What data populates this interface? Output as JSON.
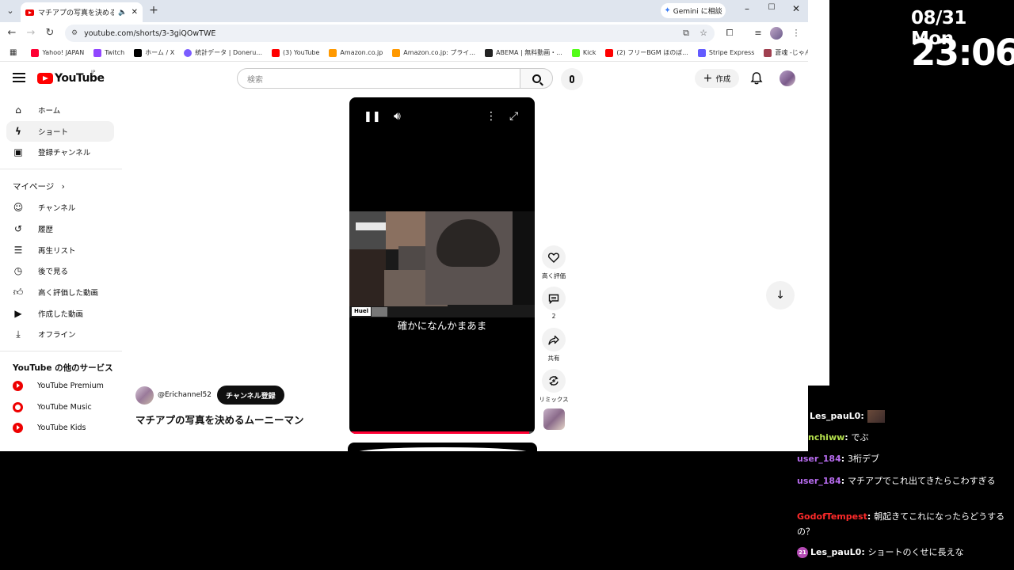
{
  "browser": {
    "tab_title": "マチアプの写真を決めるムーニー",
    "new_tab": "+",
    "gemini_label": "Gemini に相談",
    "url": "youtube.com/shorts/3-3giQOwTWE",
    "bookmarks": [
      {
        "label": "Yahoo! JAPAN",
        "color": "#ff0033"
      },
      {
        "label": "Twitch",
        "color": "#9146ff"
      },
      {
        "label": "ホーム / X",
        "color": "#000000"
      },
      {
        "label": "統計データ | Doneru...",
        "color": "#7b5cff"
      },
      {
        "label": "(3) YouTube",
        "color": "#ff0000"
      },
      {
        "label": "Amazon.co.jp",
        "color": "#ff9900"
      },
      {
        "label": "Amazon.co.jp: プライ...",
        "color": "#ff9900"
      },
      {
        "label": "ABEMA | 無料動画・...",
        "color": "#222222"
      },
      {
        "label": "Kick",
        "color": "#53fc18"
      },
      {
        "label": "(2) フリーBGM ほのぼ...",
        "color": "#ff0000"
      },
      {
        "label": "Stripe Express",
        "color": "#635bff"
      },
      {
        "label": "蒼魂 -じゃんたま-| 麻...",
        "color": "#a04050"
      }
    ],
    "more_bookmarks": "»"
  },
  "youtube": {
    "logo_text": "YouTube",
    "logo_region": "JP",
    "search_placeholder": "検索",
    "create_label": "作成",
    "sidebar": {
      "main": [
        {
          "label": "ホーム",
          "icon": "home-icon"
        },
        {
          "label": "ショート",
          "icon": "shorts-icon"
        },
        {
          "label": "登録チャンネル",
          "icon": "subscriptions-icon"
        }
      ],
      "mypage_header": "マイページ",
      "mypage": [
        {
          "label": "チャンネル",
          "icon": "channel-icon"
        },
        {
          "label": "履歴",
          "icon": "history-icon"
        },
        {
          "label": "再生リスト",
          "icon": "playlist-icon"
        },
        {
          "label": "後で見る",
          "icon": "watch-later-icon"
        },
        {
          "label": "高く評価した動画",
          "icon": "like-icon"
        },
        {
          "label": "作成した動画",
          "icon": "my-videos-icon"
        },
        {
          "label": "オフライン",
          "icon": "download-icon"
        }
      ],
      "services_header": "YouTube の他のサービス",
      "services": [
        {
          "label": "YouTube Premium"
        },
        {
          "label": "YouTube Music"
        },
        {
          "label": "YouTube Kids"
        }
      ]
    },
    "short": {
      "caption": "確かになんかまあま",
      "progress": 0.97,
      "actions": {
        "like_label": "高く評価",
        "comment_count": "2",
        "share_label": "共有",
        "remix_label": "リミックス"
      },
      "channel_name": "@Erichannel52",
      "subscribe_label": "チャンネル登録",
      "title": "マチアプの写真を決めるムーニーマン",
      "watermark": "Huel"
    }
  },
  "overlay": {
    "date": "08/31 Mon",
    "time": "23:06",
    "chat": [
      {
        "user": "Les_pauL0",
        "user_color": "#ffffff",
        "text": ""
      },
      {
        "user": "nchiww",
        "user_color": "#b4e04c",
        "text": "でぶ"
      },
      {
        "user": "user_184",
        "user_color": "#b86cf0",
        "text": "3桁デブ"
      },
      {
        "user": "user_184",
        "user_color": "#b86cf0",
        "text": "マチアプでこれ出てきたらこわすぎる"
      },
      {
        "user": "GodofTempest",
        "user_color": "#ff2a2a",
        "text": "朝起きてこれになったらどうするの？"
      },
      {
        "user": "Les_pauL0",
        "user_color": "#ffffff",
        "text": "ショートのくせに長えな",
        "badge": "21"
      }
    ]
  }
}
